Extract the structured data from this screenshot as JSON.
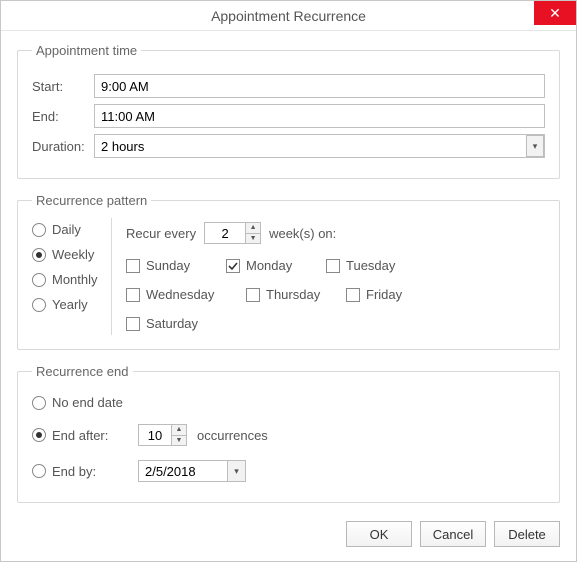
{
  "title": "Appointment Recurrence",
  "appointmentTime": {
    "legend": "Appointment time",
    "startLabel": "Start:",
    "startValue": "9:00 AM",
    "endLabel": "End:",
    "endValue": "11:00 AM",
    "durationLabel": "Duration:",
    "durationValue": "2 hours"
  },
  "pattern": {
    "legend": "Recurrence pattern",
    "options": {
      "daily": "Daily",
      "weekly": "Weekly",
      "monthly": "Monthly",
      "yearly": "Yearly"
    },
    "recurEveryPrefix": "Recur every",
    "recurEveryValue": "2",
    "recurEverySuffix": "week(s) on:",
    "days": {
      "sunday": "Sunday",
      "monday": "Monday",
      "tuesday": "Tuesday",
      "wednesday": "Wednesday",
      "thursday": "Thursday",
      "friday": "Friday",
      "saturday": "Saturday"
    }
  },
  "end": {
    "legend": "Recurrence end",
    "noEnd": "No end date",
    "endAfter": "End after:",
    "endAfterValue": "10",
    "occurrences": "occurrences",
    "endBy": "End by:",
    "endByValue": "2/5/2018"
  },
  "buttons": {
    "ok": "OK",
    "cancel": "Cancel",
    "delete": "Delete"
  }
}
